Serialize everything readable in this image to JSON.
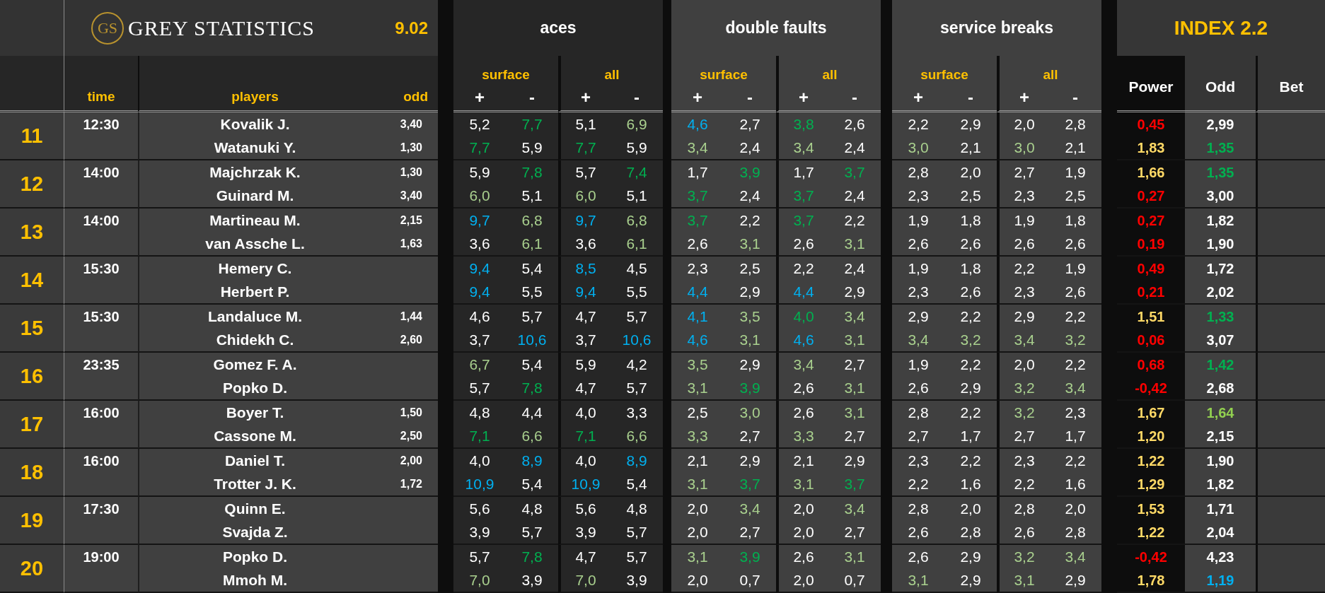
{
  "logo": {
    "monogram": "GS",
    "text": "GREY STATISTICS"
  },
  "version": "9.02",
  "columns": {
    "time": "time",
    "players": "players",
    "odd": "odd"
  },
  "groups": [
    {
      "title": "aces",
      "subgroups": [
        {
          "label": "surface",
          "signs": [
            "+",
            "-"
          ]
        },
        {
          "label": "all",
          "signs": [
            "+",
            "-"
          ]
        }
      ]
    },
    {
      "title": "double faults",
      "subgroups": [
        {
          "label": "surface",
          "signs": [
            "+",
            "-"
          ]
        },
        {
          "label": "all",
          "signs": [
            "+",
            "-"
          ]
        }
      ]
    },
    {
      "title": "service breaks",
      "subgroups": [
        {
          "label": "surface",
          "signs": [
            "+",
            "-"
          ]
        },
        {
          "label": "all",
          "signs": [
            "+",
            "-"
          ]
        }
      ]
    }
  ],
  "index": {
    "title": "INDEX 2.2",
    "columns": [
      "Power",
      "Odd",
      "Bet"
    ]
  },
  "matches": [
    {
      "number": "11",
      "time": "12:30",
      "players": [
        {
          "name": "Kovalik J.",
          "odd": "3,40",
          "stats": [
            {
              "text": "5,2",
              "color": "#ffffff"
            },
            {
              "text": "7,7",
              "color": "#00b050"
            },
            {
              "text": "5,1",
              "color": "#ffffff"
            },
            {
              "text": "6,9",
              "color": "#a9d08e"
            },
            {
              "text": "4,6",
              "color": "#00b0f0"
            },
            {
              "text": "2,7",
              "color": "#ffffff"
            },
            {
              "text": "3,8",
              "color": "#00b050"
            },
            {
              "text": "2,6",
              "color": "#ffffff"
            },
            {
              "text": "2,2",
              "color": "#ffffff"
            },
            {
              "text": "2,9",
              "color": "#ffffff"
            },
            {
              "text": "2,0",
              "color": "#ffffff"
            },
            {
              "text": "2,8",
              "color": "#ffffff"
            }
          ],
          "power": {
            "text": "0,45",
            "color": "#ff0000"
          },
          "index_odd": {
            "text": "2,99",
            "color": "#ffffff"
          }
        },
        {
          "name": "Watanuki Y.",
          "odd": "1,30",
          "stats": [
            {
              "text": "7,7",
              "color": "#00b050"
            },
            {
              "text": "5,9",
              "color": "#ffffff"
            },
            {
              "text": "7,7",
              "color": "#00b050"
            },
            {
              "text": "5,9",
              "color": "#ffffff"
            },
            {
              "text": "3,4",
              "color": "#a9d08e"
            },
            {
              "text": "2,4",
              "color": "#ffffff"
            },
            {
              "text": "3,4",
              "color": "#a9d08e"
            },
            {
              "text": "2,4",
              "color": "#ffffff"
            },
            {
              "text": "3,0",
              "color": "#a9d08e"
            },
            {
              "text": "2,1",
              "color": "#ffffff"
            },
            {
              "text": "3,0",
              "color": "#a9d08e"
            },
            {
              "text": "2,1",
              "color": "#ffffff"
            }
          ],
          "power": {
            "text": "1,83",
            "color": "#ffd966"
          },
          "index_odd": {
            "text": "1,35",
            "color": "#00b050"
          }
        }
      ]
    },
    {
      "number": "12",
      "time": "14:00",
      "players": [
        {
          "name": "Majchrzak K.",
          "odd": "1,30",
          "stats": [
            {
              "text": "5,9",
              "color": "#ffffff"
            },
            {
              "text": "7,8",
              "color": "#00b050"
            },
            {
              "text": "5,7",
              "color": "#ffffff"
            },
            {
              "text": "7,4",
              "color": "#00b050"
            },
            {
              "text": "1,7",
              "color": "#ffffff"
            },
            {
              "text": "3,9",
              "color": "#00b050"
            },
            {
              "text": "1,7",
              "color": "#ffffff"
            },
            {
              "text": "3,7",
              "color": "#00b050"
            },
            {
              "text": "2,8",
              "color": "#ffffff"
            },
            {
              "text": "2,0",
              "color": "#ffffff"
            },
            {
              "text": "2,7",
              "color": "#ffffff"
            },
            {
              "text": "1,9",
              "color": "#ffffff"
            }
          ],
          "power": {
            "text": "1,66",
            "color": "#ffd966"
          },
          "index_odd": {
            "text": "1,35",
            "color": "#00b050"
          }
        },
        {
          "name": "Guinard M.",
          "odd": "3,40",
          "stats": [
            {
              "text": "6,0",
              "color": "#a9d08e"
            },
            {
              "text": "5,1",
              "color": "#ffffff"
            },
            {
              "text": "6,0",
              "color": "#a9d08e"
            },
            {
              "text": "5,1",
              "color": "#ffffff"
            },
            {
              "text": "3,7",
              "color": "#00b050"
            },
            {
              "text": "2,4",
              "color": "#ffffff"
            },
            {
              "text": "3,7",
              "color": "#00b050"
            },
            {
              "text": "2,4",
              "color": "#ffffff"
            },
            {
              "text": "2,3",
              "color": "#ffffff"
            },
            {
              "text": "2,5",
              "color": "#ffffff"
            },
            {
              "text": "2,3",
              "color": "#ffffff"
            },
            {
              "text": "2,5",
              "color": "#ffffff"
            }
          ],
          "power": {
            "text": "0,27",
            "color": "#ff0000"
          },
          "index_odd": {
            "text": "3,00",
            "color": "#ffffff"
          }
        }
      ]
    },
    {
      "number": "13",
      "time": "14:00",
      "players": [
        {
          "name": "Martineau M.",
          "odd": "2,15",
          "stats": [
            {
              "text": "9,7",
              "color": "#00b0f0"
            },
            {
              "text": "6,8",
              "color": "#a9d08e"
            },
            {
              "text": "9,7",
              "color": "#00b0f0"
            },
            {
              "text": "6,8",
              "color": "#a9d08e"
            },
            {
              "text": "3,7",
              "color": "#00b050"
            },
            {
              "text": "2,2",
              "color": "#ffffff"
            },
            {
              "text": "3,7",
              "color": "#00b050"
            },
            {
              "text": "2,2",
              "color": "#ffffff"
            },
            {
              "text": "1,9",
              "color": "#ffffff"
            },
            {
              "text": "1,8",
              "color": "#ffffff"
            },
            {
              "text": "1,9",
              "color": "#ffffff"
            },
            {
              "text": "1,8",
              "color": "#ffffff"
            }
          ],
          "power": {
            "text": "0,27",
            "color": "#ff0000"
          },
          "index_odd": {
            "text": "1,82",
            "color": "#ffffff"
          }
        },
        {
          "name": "van Assche L.",
          "odd": "1,63",
          "stats": [
            {
              "text": "3,6",
              "color": "#ffffff"
            },
            {
              "text": "6,1",
              "color": "#a9d08e"
            },
            {
              "text": "3,6",
              "color": "#ffffff"
            },
            {
              "text": "6,1",
              "color": "#a9d08e"
            },
            {
              "text": "2,6",
              "color": "#ffffff"
            },
            {
              "text": "3,1",
              "color": "#a9d08e"
            },
            {
              "text": "2,6",
              "color": "#ffffff"
            },
            {
              "text": "3,1",
              "color": "#a9d08e"
            },
            {
              "text": "2,6",
              "color": "#ffffff"
            },
            {
              "text": "2,6",
              "color": "#ffffff"
            },
            {
              "text": "2,6",
              "color": "#ffffff"
            },
            {
              "text": "2,6",
              "color": "#ffffff"
            }
          ],
          "power": {
            "text": "0,19",
            "color": "#ff0000"
          },
          "index_odd": {
            "text": "1,90",
            "color": "#ffffff"
          }
        }
      ]
    },
    {
      "number": "14",
      "time": "15:30",
      "players": [
        {
          "name": "Hemery C.",
          "stats": [
            {
              "text": "9,4",
              "color": "#00b0f0"
            },
            {
              "text": "5,4",
              "color": "#ffffff"
            },
            {
              "text": "8,5",
              "color": "#00b0f0"
            },
            {
              "text": "4,5",
              "color": "#ffffff"
            },
            {
              "text": "2,3",
              "color": "#ffffff"
            },
            {
              "text": "2,5",
              "color": "#ffffff"
            },
            {
              "text": "2,2",
              "color": "#ffffff"
            },
            {
              "text": "2,4",
              "color": "#ffffff"
            },
            {
              "text": "1,9",
              "color": "#ffffff"
            },
            {
              "text": "1,8",
              "color": "#ffffff"
            },
            {
              "text": "2,2",
              "color": "#ffffff"
            },
            {
              "text": "1,9",
              "color": "#ffffff"
            }
          ],
          "power": {
            "text": "0,49",
            "color": "#ff0000"
          },
          "index_odd": {
            "text": "1,72",
            "color": "#ffffff"
          }
        },
        {
          "name": "Herbert P.",
          "stats": [
            {
              "text": "9,4",
              "color": "#00b0f0"
            },
            {
              "text": "5,5",
              "color": "#ffffff"
            },
            {
              "text": "9,4",
              "color": "#00b0f0"
            },
            {
              "text": "5,5",
              "color": "#ffffff"
            },
            {
              "text": "4,4",
              "color": "#00b0f0"
            },
            {
              "text": "2,9",
              "color": "#ffffff"
            },
            {
              "text": "4,4",
              "color": "#00b0f0"
            },
            {
              "text": "2,9",
              "color": "#ffffff"
            },
            {
              "text": "2,3",
              "color": "#ffffff"
            },
            {
              "text": "2,6",
              "color": "#ffffff"
            },
            {
              "text": "2,3",
              "color": "#ffffff"
            },
            {
              "text": "2,6",
              "color": "#ffffff"
            }
          ],
          "power": {
            "text": "0,21",
            "color": "#ff0000"
          },
          "index_odd": {
            "text": "2,02",
            "color": "#ffffff"
          }
        }
      ]
    },
    {
      "number": "15",
      "time": "15:30",
      "players": [
        {
          "name": "Landaluce M.",
          "odd": "1,44",
          "stats": [
            {
              "text": "4,6",
              "color": "#ffffff"
            },
            {
              "text": "5,7",
              "color": "#ffffff"
            },
            {
              "text": "4,7",
              "color": "#ffffff"
            },
            {
              "text": "5,7",
              "color": "#ffffff"
            },
            {
              "text": "4,1",
              "color": "#00b0f0"
            },
            {
              "text": "3,5",
              "color": "#a9d08e"
            },
            {
              "text": "4,0",
              "color": "#00b050"
            },
            {
              "text": "3,4",
              "color": "#a9d08e"
            },
            {
              "text": "2,9",
              "color": "#ffffff"
            },
            {
              "text": "2,2",
              "color": "#ffffff"
            },
            {
              "text": "2,9",
              "color": "#ffffff"
            },
            {
              "text": "2,2",
              "color": "#ffffff"
            }
          ],
          "power": {
            "text": "1,51",
            "color": "#ffd966"
          },
          "index_odd": {
            "text": "1,33",
            "color": "#00b050"
          }
        },
        {
          "name": "Chidekh C.",
          "odd": "2,60",
          "stats": [
            {
              "text": "3,7",
              "color": "#ffffff"
            },
            {
              "text": "10,6",
              "color": "#00b0f0"
            },
            {
              "text": "3,7",
              "color": "#ffffff"
            },
            {
              "text": "10,6",
              "color": "#00b0f0"
            },
            {
              "text": "4,6",
              "color": "#00b0f0"
            },
            {
              "text": "3,1",
              "color": "#a9d08e"
            },
            {
              "text": "4,6",
              "color": "#00b0f0"
            },
            {
              "text": "3,1",
              "color": "#a9d08e"
            },
            {
              "text": "3,4",
              "color": "#a9d08e"
            },
            {
              "text": "3,2",
              "color": "#a9d08e"
            },
            {
              "text": "3,4",
              "color": "#a9d08e"
            },
            {
              "text": "3,2",
              "color": "#a9d08e"
            }
          ],
          "power": {
            "text": "0,06",
            "color": "#ff0000"
          },
          "index_odd": {
            "text": "3,07",
            "color": "#ffffff"
          }
        }
      ]
    },
    {
      "number": "16",
      "time": "23:35",
      "players": [
        {
          "name": "Gomez F. A.",
          "stats": [
            {
              "text": "6,7",
              "color": "#a9d08e"
            },
            {
              "text": "5,4",
              "color": "#ffffff"
            },
            {
              "text": "5,9",
              "color": "#ffffff"
            },
            {
              "text": "4,2",
              "color": "#ffffff"
            },
            {
              "text": "3,5",
              "color": "#a9d08e"
            },
            {
              "text": "2,9",
              "color": "#ffffff"
            },
            {
              "text": "3,4",
              "color": "#a9d08e"
            },
            {
              "text": "2,7",
              "color": "#ffffff"
            },
            {
              "text": "1,9",
              "color": "#ffffff"
            },
            {
              "text": "2,2",
              "color": "#ffffff"
            },
            {
              "text": "2,0",
              "color": "#ffffff"
            },
            {
              "text": "2,2",
              "color": "#ffffff"
            }
          ],
          "power": {
            "text": "0,68",
            "color": "#ff0000"
          },
          "index_odd": {
            "text": "1,42",
            "color": "#00b050"
          }
        },
        {
          "name": "Popko D.",
          "stats": [
            {
              "text": "5,7",
              "color": "#ffffff"
            },
            {
              "text": "7,8",
              "color": "#00b050"
            },
            {
              "text": "4,7",
              "color": "#ffffff"
            },
            {
              "text": "5,7",
              "color": "#ffffff"
            },
            {
              "text": "3,1",
              "color": "#a9d08e"
            },
            {
              "text": "3,9",
              "color": "#00b050"
            },
            {
              "text": "2,6",
              "color": "#ffffff"
            },
            {
              "text": "3,1",
              "color": "#a9d08e"
            },
            {
              "text": "2,6",
              "color": "#ffffff"
            },
            {
              "text": "2,9",
              "color": "#ffffff"
            },
            {
              "text": "3,2",
              "color": "#a9d08e"
            },
            {
              "text": "3,4",
              "color": "#a9d08e"
            }
          ],
          "power": {
            "text": "-0,42",
            "color": "#ff0000"
          },
          "index_odd": {
            "text": "2,68",
            "color": "#ffffff"
          }
        }
      ]
    },
    {
      "number": "17",
      "time": "16:00",
      "players": [
        {
          "name": "Boyer T.",
          "odd": "1,50",
          "stats": [
            {
              "text": "4,8",
              "color": "#ffffff"
            },
            {
              "text": "4,4",
              "color": "#ffffff"
            },
            {
              "text": "4,0",
              "color": "#ffffff"
            },
            {
              "text": "3,3",
              "color": "#ffffff"
            },
            {
              "text": "2,5",
              "color": "#ffffff"
            },
            {
              "text": "3,0",
              "color": "#a9d08e"
            },
            {
              "text": "2,6",
              "color": "#ffffff"
            },
            {
              "text": "3,1",
              "color": "#a9d08e"
            },
            {
              "text": "2,8",
              "color": "#ffffff"
            },
            {
              "text": "2,2",
              "color": "#ffffff"
            },
            {
              "text": "3,2",
              "color": "#a9d08e"
            },
            {
              "text": "2,3",
              "color": "#ffffff"
            }
          ],
          "power": {
            "text": "1,67",
            "color": "#ffd966"
          },
          "index_odd": {
            "text": "1,64",
            "color": "#92d050"
          }
        },
        {
          "name": "Cassone M.",
          "odd": "2,50",
          "stats": [
            {
              "text": "7,1",
              "color": "#00b050"
            },
            {
              "text": "6,6",
              "color": "#a9d08e"
            },
            {
              "text": "7,1",
              "color": "#00b050"
            },
            {
              "text": "6,6",
              "color": "#a9d08e"
            },
            {
              "text": "3,3",
              "color": "#a9d08e"
            },
            {
              "text": "2,7",
              "color": "#ffffff"
            },
            {
              "text": "3,3",
              "color": "#a9d08e"
            },
            {
              "text": "2,7",
              "color": "#ffffff"
            },
            {
              "text": "2,7",
              "color": "#ffffff"
            },
            {
              "text": "1,7",
              "color": "#ffffff"
            },
            {
              "text": "2,7",
              "color": "#ffffff"
            },
            {
              "text": "1,7",
              "color": "#ffffff"
            }
          ],
          "power": {
            "text": "1,20",
            "color": "#ffd966"
          },
          "index_odd": {
            "text": "2,15",
            "color": "#ffffff"
          }
        }
      ]
    },
    {
      "number": "18",
      "time": "16:00",
      "players": [
        {
          "name": "Daniel T.",
          "odd": "2,00",
          "stats": [
            {
              "text": "4,0",
              "color": "#ffffff"
            },
            {
              "text": "8,9",
              "color": "#00b0f0"
            },
            {
              "text": "4,0",
              "color": "#ffffff"
            },
            {
              "text": "8,9",
              "color": "#00b0f0"
            },
            {
              "text": "2,1",
              "color": "#ffffff"
            },
            {
              "text": "2,9",
              "color": "#ffffff"
            },
            {
              "text": "2,1",
              "color": "#ffffff"
            },
            {
              "text": "2,9",
              "color": "#ffffff"
            },
            {
              "text": "2,3",
              "color": "#ffffff"
            },
            {
              "text": "2,2",
              "color": "#ffffff"
            },
            {
              "text": "2,3",
              "color": "#ffffff"
            },
            {
              "text": "2,2",
              "color": "#ffffff"
            }
          ],
          "power": {
            "text": "1,22",
            "color": "#ffd966"
          },
          "index_odd": {
            "text": "1,90",
            "color": "#ffffff"
          }
        },
        {
          "name": "Trotter J. K.",
          "odd": "1,72",
          "stats": [
            {
              "text": "10,9",
              "color": "#00b0f0"
            },
            {
              "text": "5,4",
              "color": "#ffffff"
            },
            {
              "text": "10,9",
              "color": "#00b0f0"
            },
            {
              "text": "5,4",
              "color": "#ffffff"
            },
            {
              "text": "3,1",
              "color": "#a9d08e"
            },
            {
              "text": "3,7",
              "color": "#00b050"
            },
            {
              "text": "3,1",
              "color": "#a9d08e"
            },
            {
              "text": "3,7",
              "color": "#00b050"
            },
            {
              "text": "2,2",
              "color": "#ffffff"
            },
            {
              "text": "1,6",
              "color": "#ffffff"
            },
            {
              "text": "2,2",
              "color": "#ffffff"
            },
            {
              "text": "1,6",
              "color": "#ffffff"
            }
          ],
          "power": {
            "text": "1,29",
            "color": "#ffd966"
          },
          "index_odd": {
            "text": "1,82",
            "color": "#ffffff"
          }
        }
      ]
    },
    {
      "number": "19",
      "time": "17:30",
      "players": [
        {
          "name": "Quinn E.",
          "stats": [
            {
              "text": "5,6",
              "color": "#ffffff"
            },
            {
              "text": "4,8",
              "color": "#ffffff"
            },
            {
              "text": "5,6",
              "color": "#ffffff"
            },
            {
              "text": "4,8",
              "color": "#ffffff"
            },
            {
              "text": "2,0",
              "color": "#ffffff"
            },
            {
              "text": "3,4",
              "color": "#a9d08e"
            },
            {
              "text": "2,0",
              "color": "#ffffff"
            },
            {
              "text": "3,4",
              "color": "#a9d08e"
            },
            {
              "text": "2,8",
              "color": "#ffffff"
            },
            {
              "text": "2,0",
              "color": "#ffffff"
            },
            {
              "text": "2,8",
              "color": "#ffffff"
            },
            {
              "text": "2,0",
              "color": "#ffffff"
            }
          ],
          "power": {
            "text": "1,53",
            "color": "#ffd966"
          },
          "index_odd": {
            "text": "1,71",
            "color": "#ffffff"
          }
        },
        {
          "name": "Svajda Z.",
          "stats": [
            {
              "text": "3,9",
              "color": "#ffffff"
            },
            {
              "text": "5,7",
              "color": "#ffffff"
            },
            {
              "text": "3,9",
              "color": "#ffffff"
            },
            {
              "text": "5,7",
              "color": "#ffffff"
            },
            {
              "text": "2,0",
              "color": "#ffffff"
            },
            {
              "text": "2,7",
              "color": "#ffffff"
            },
            {
              "text": "2,0",
              "color": "#ffffff"
            },
            {
              "text": "2,7",
              "color": "#ffffff"
            },
            {
              "text": "2,6",
              "color": "#ffffff"
            },
            {
              "text": "2,8",
              "color": "#ffffff"
            },
            {
              "text": "2,6",
              "color": "#ffffff"
            },
            {
              "text": "2,8",
              "color": "#ffffff"
            }
          ],
          "power": {
            "text": "1,22",
            "color": "#ffd966"
          },
          "index_odd": {
            "text": "2,04",
            "color": "#ffffff"
          }
        }
      ]
    },
    {
      "number": "20",
      "time": "19:00",
      "players": [
        {
          "name": "Popko D.",
          "stats": [
            {
              "text": "5,7",
              "color": "#ffffff"
            },
            {
              "text": "7,8",
              "color": "#00b050"
            },
            {
              "text": "4,7",
              "color": "#ffffff"
            },
            {
              "text": "5,7",
              "color": "#ffffff"
            },
            {
              "text": "3,1",
              "color": "#a9d08e"
            },
            {
              "text": "3,9",
              "color": "#00b050"
            },
            {
              "text": "2,6",
              "color": "#ffffff"
            },
            {
              "text": "3,1",
              "color": "#a9d08e"
            },
            {
              "text": "2,6",
              "color": "#ffffff"
            },
            {
              "text": "2,9",
              "color": "#ffffff"
            },
            {
              "text": "3,2",
              "color": "#a9d08e"
            },
            {
              "text": "3,4",
              "color": "#a9d08e"
            }
          ],
          "power": {
            "text": "-0,42",
            "color": "#ff0000"
          },
          "index_odd": {
            "text": "4,23",
            "color": "#ffffff"
          }
        },
        {
          "name": "Mmoh M.",
          "stats": [
            {
              "text": "7,0",
              "color": "#a9d08e"
            },
            {
              "text": "3,9",
              "color": "#ffffff"
            },
            {
              "text": "7,0",
              "color": "#a9d08e"
            },
            {
              "text": "3,9",
              "color": "#ffffff"
            },
            {
              "text": "2,0",
              "color": "#ffffff"
            },
            {
              "text": "0,7",
              "color": "#ffffff"
            },
            {
              "text": "2,0",
              "color": "#ffffff"
            },
            {
              "text": "0,7",
              "color": "#ffffff"
            },
            {
              "text": "3,1",
              "color": "#a9d08e"
            },
            {
              "text": "2,9",
              "color": "#ffffff"
            },
            {
              "text": "3,1",
              "color": "#a9d08e"
            },
            {
              "text": "2,9",
              "color": "#ffffff"
            }
          ],
          "power": {
            "text": "1,78",
            "color": "#ffd966"
          },
          "index_odd": {
            "text": "1,19",
            "color": "#00b0f0"
          }
        }
      ]
    }
  ]
}
